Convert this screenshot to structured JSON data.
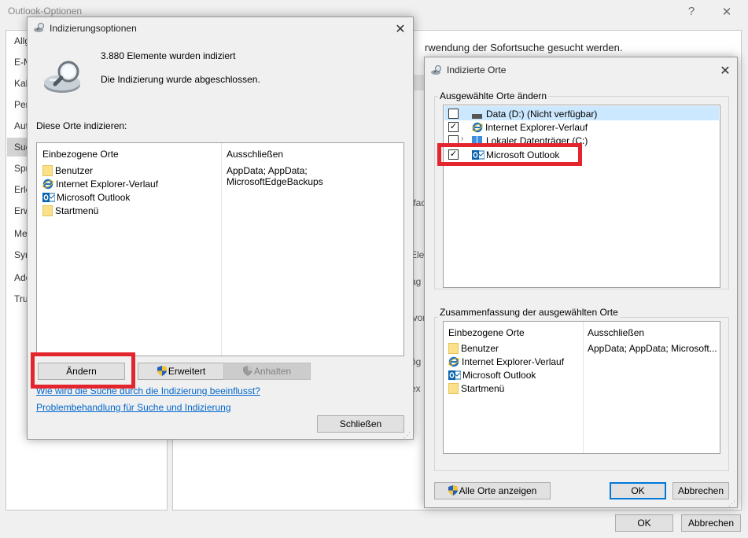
{
  "options_window": {
    "title": "Outlook-Optionen",
    "help_glyph": "?",
    "close_glyph": "✕",
    "nav_fragments": [
      "Allg",
      "E-M",
      "Kal",
      "Per",
      "Aut",
      "Suc",
      "Spr",
      "Erle",
      "Erw",
      "Me",
      "Syr",
      "Adc",
      "Tru"
    ],
    "search_text_fragment": "rwendung der Sofortsuche gesucht werden.",
    "right_fragments": [
      "tfac",
      "Ele",
      "ag",
      "ivor",
      "ög",
      "ex"
    ],
    "ok_label": "OK",
    "cancel_label": "Abbrechen"
  },
  "indexing_dialog": {
    "title": "Indizierungsoptionen",
    "close_glyph": "✕",
    "count_text": "3.880 Elemente wurden indiziert",
    "status_text": "Die Indizierung wurde abgeschlossen.",
    "locations_label": "Diese Orte indizieren:",
    "col_included": "Einbezogene Orte",
    "col_excluded": "Ausschließen",
    "items": [
      {
        "label": "Benutzer",
        "icon": "folder-icon"
      },
      {
        "label": "Internet Explorer-Verlauf",
        "icon": "internet-explorer-icon"
      },
      {
        "label": "Microsoft Outlook",
        "icon": "outlook-icon"
      },
      {
        "label": "Startmenü",
        "icon": "folder-icon"
      }
    ],
    "exclusions": "AppData; AppData; MicrosoftEdgeBackups",
    "modify_label": "Ändern",
    "advanced_label": "Erweitert",
    "pause_label": "Anhalten",
    "help_link": "Wie wird die Suche durch die Indizierung beeinflusst?",
    "troubleshoot_link": "Problembehandlung für Suche und Indizierung",
    "close_label": "Schließen"
  },
  "locations_dialog": {
    "title": "Indizierte Orte",
    "close_glyph": "✕",
    "change_group_label": "Ausgewählte Orte ändern",
    "tree_items": [
      {
        "label": "Data (D:) (Nicht verfügbar)",
        "checked": false,
        "icon": "drive-icon"
      },
      {
        "label": "Internet Explorer-Verlauf",
        "checked": true,
        "icon": "internet-explorer-icon"
      },
      {
        "label": "Lokaler Datenträger (C:)",
        "checked": false,
        "icon": "windows-drive-icon"
      },
      {
        "label": "Microsoft Outlook",
        "checked": true,
        "icon": "outlook-icon"
      }
    ],
    "summary_group_label": "Zusammenfassung der ausgewählten Orte",
    "col_included": "Einbezogene Orte",
    "col_excluded": "Ausschließen",
    "summary_items": [
      {
        "label": "Benutzer",
        "icon": "folder-icon"
      },
      {
        "label": "Internet Explorer-Verlauf",
        "icon": "internet-explorer-icon"
      },
      {
        "label": "Microsoft Outlook",
        "icon": "outlook-icon"
      },
      {
        "label": "Startmenü",
        "icon": "folder-icon"
      }
    ],
    "summary_exclusions": "AppData; AppData; Microsoft...",
    "show_all_label": "Alle Orte anzeigen",
    "ok_label": "OK",
    "cancel_label": "Abbrechen"
  },
  "colors": {
    "highlight_box": "#e3262e",
    "selected_row": "#cce8ff",
    "link": "#0066cc",
    "accent": "#0078d7"
  }
}
